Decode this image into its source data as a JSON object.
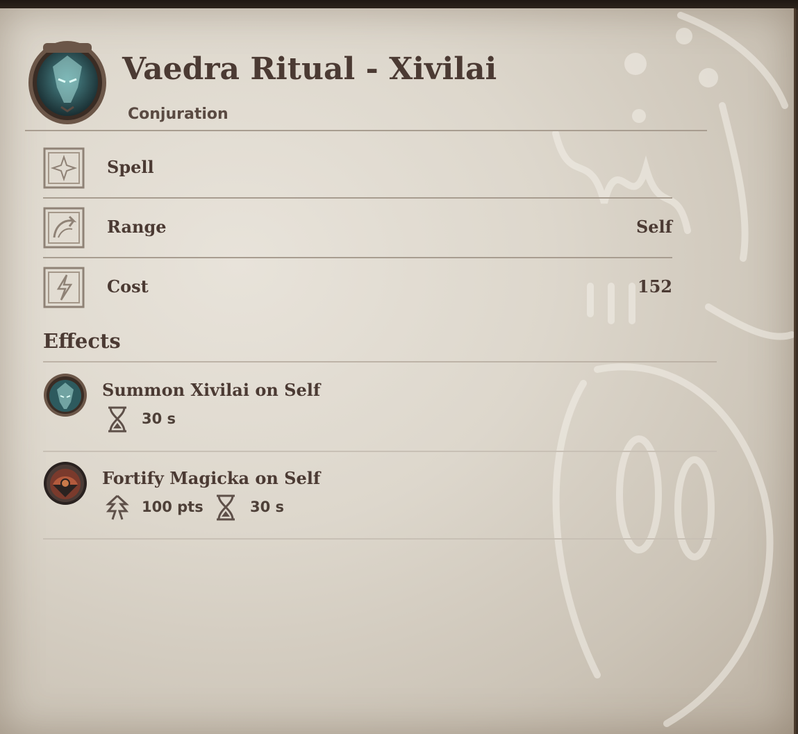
{
  "spell": {
    "title": "Vaedra Ritual - Xivilai",
    "school": "Conjuration",
    "icon": "xivilai-mask-icon"
  },
  "properties": [
    {
      "label": "Spell",
      "value": "",
      "icon": "spell-star-icon"
    },
    {
      "label": "Range",
      "value": "Self",
      "icon": "range-arrow-icon"
    },
    {
      "label": "Cost",
      "value": "152",
      "icon": "cost-lightning-icon"
    }
  ],
  "effects_title": "Effects",
  "effects": [
    {
      "name": "Summon Xivilai on Self",
      "icon": "xivilai-mask-icon",
      "duration": "30 s"
    },
    {
      "name": "Fortify Magicka on Self",
      "icon": "fortify-magicka-icon",
      "magnitude": "100 pts",
      "duration": "30 s"
    }
  ],
  "colors": {
    "parchment": "#ddd7cc",
    "ink": "#4b3a33",
    "rule": "#a89d90"
  }
}
